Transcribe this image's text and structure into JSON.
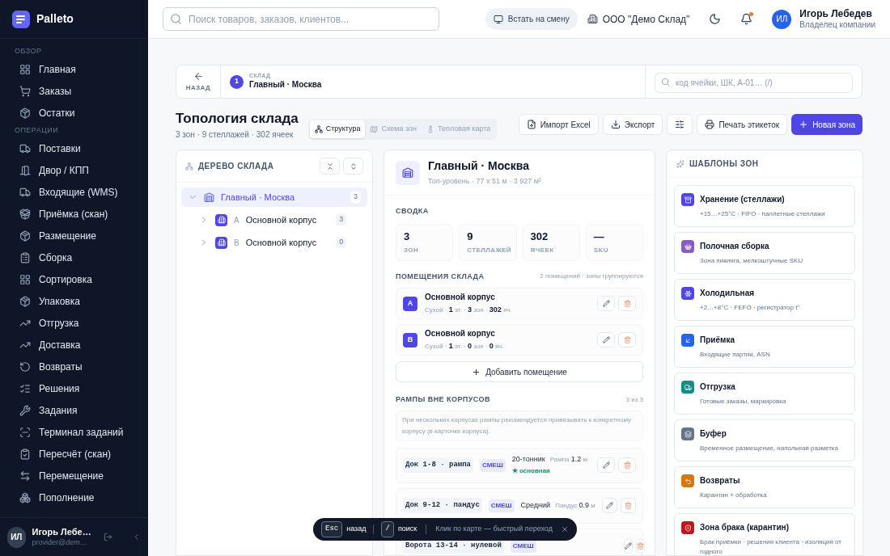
{
  "sidebar": {
    "brand": "Palleto",
    "sections": [
      {
        "title": "ОБЗОР",
        "items": [
          {
            "label": "Главная",
            "selected": false
          },
          {
            "label": "Заказы",
            "selected": false
          },
          {
            "label": "Остатки",
            "selected": false
          }
        ]
      },
      {
        "title": "ОПЕРАЦИИ",
        "items": [
          {
            "label": "Поставки",
            "selected": false
          },
          {
            "label": "Двор / КПП",
            "selected": false
          },
          {
            "label": "Входящие (WMS)",
            "selected": false
          },
          {
            "label": "Приёмка (скан)",
            "selected": false
          },
          {
            "label": "Размещение",
            "selected": false
          },
          {
            "label": "Сборка",
            "selected": false
          },
          {
            "label": "Сортировка",
            "selected": false
          },
          {
            "label": "Упаковка",
            "selected": false
          },
          {
            "label": "Отгрузка",
            "selected": false
          },
          {
            "label": "Доставка",
            "selected": false
          },
          {
            "label": "Возвраты",
            "selected": false
          },
          {
            "label": "Решения",
            "selected": false
          },
          {
            "label": "Задания",
            "selected": false
          },
          {
            "label": "Терминал заданий",
            "selected": false
          },
          {
            "label": "Пересчёт (скан)",
            "selected": false
          },
          {
            "label": "Перемещение",
            "selected": false
          },
          {
            "label": "Пополнение",
            "selected": false
          }
        ]
      }
    ],
    "user": {
      "initials": "ИЛ",
      "name": "Игорь Лебе…",
      "email": "provider@dem…"
    }
  },
  "topbar": {
    "search_placeholder": "Поиск товаров, заказов, клиентов...",
    "shift_button": "Встать на смену",
    "org": "ООО \"Демо Склад\"",
    "notifications_unread": true,
    "user": {
      "initials": "ИЛ",
      "name": "Игорь Лебедев",
      "role": "Владелец компании"
    }
  },
  "breadcrumb": {
    "back": "НАЗАД",
    "step": "1",
    "label": "СКЛАД",
    "value": "Главный · Москва",
    "search_placeholder": "код ячейки, ШК, A-01… (/)"
  },
  "page": {
    "title": "Топология склада",
    "subtitle": "3 зон · 9 стеллажей · 302 ячеек",
    "views": [
      {
        "label": "Структура",
        "selected": true
      },
      {
        "label": "Схема зон",
        "selected": false
      },
      {
        "label": "Тепловая карта",
        "selected": false
      }
    ],
    "actions": [
      {
        "kind": "default",
        "label": "Импорт Excel"
      },
      {
        "kind": "default",
        "label": "Экспорт"
      },
      {
        "kind": "icon"
      },
      {
        "kind": "default",
        "label": "Печать этикеток"
      },
      {
        "kind": "primary",
        "label": "Новая зона"
      }
    ]
  },
  "tree": {
    "title": "ДЕРЕВО СКЛАДА",
    "nodes": [
      {
        "label": "Главный · Москва",
        "count": "3",
        "expanded": true,
        "selected": true,
        "children": [
          {
            "letter": "A",
            "label": "Основной корпус",
            "count": "3",
            "expanded": false,
            "selected": false
          },
          {
            "letter": "B",
            "label": "Основной корпус",
            "count": "0",
            "expanded": false,
            "selected": false
          }
        ]
      }
    ]
  },
  "detail": {
    "title": "Главный · Москва",
    "subtitle": "Топ-уровень · 77 x 51 м · 3 927 м²",
    "summary_title": "СВОДКА",
    "stats": [
      {
        "value": "3",
        "label": "ЗОН"
      },
      {
        "value": "9",
        "label": "СТЕЛЛАЖЕЙ"
      },
      {
        "value": "302",
        "label": "ЯЧЕЕК"
      },
      {
        "value": "—",
        "label": "SKU"
      }
    ],
    "rooms_title": "ПОМЕЩЕНИЯ СКЛАДА",
    "rooms_note": "2 помещений · зоны группируются",
    "rooms": [
      {
        "letter": "A",
        "name": "Основной корпус",
        "meta": "Сухой · **1** эт. · **3** зон · **302** яч."
      },
      {
        "letter": "B",
        "name": "Основной корпус",
        "meta": "Сухой · **1** эт. · **0** зон · **0** яч."
      }
    ],
    "add_room": "Добавить помещение",
    "ramps_title": "РАМПЫ ВНЕ КОРПУСОВ",
    "ramps_count": "3 из 3",
    "ramps_note": "При нескольких корпусах рампы рекомендуется привязывать к конкретному корпусу (в карточке корпуса).",
    "ramps": [
      {
        "code": "Док 1-8 · рампа",
        "tag": "СМЕШ",
        "type": "20-тонник",
        "spec": "Рампа **1.2** м",
        "badge": "★ основная"
      },
      {
        "code": "Док 9-12 · пандус",
        "tag": "СМЕШ",
        "type": "Средний",
        "spec": "Пандус **0.9** м"
      },
      {
        "code": "Ворота 13-14 · нулевой",
        "tag": "СМЕШ"
      }
    ]
  },
  "templates": {
    "title": "ШАБЛОНЫ ЗОН",
    "items": [
      {
        "title": "Хранение (стеллажи)",
        "desc": "+15…+25°C · FIFO · паллетные стеллажи",
        "color": "#4f46e5"
      },
      {
        "title": "Полочная сборка",
        "desc": "Зона пикинга, мелкоштучные SKU",
        "color": "#8b5cc0"
      },
      {
        "title": "Холодильная",
        "desc": "+2…+8°C · FEFO · регистратор t°",
        "color": "#4f46e5"
      },
      {
        "title": "Приёмка",
        "desc": "Входящие партии, ASN",
        "color": "#2563eb"
      },
      {
        "title": "Отгрузка",
        "desc": "Готовые заказы, маркировка",
        "color": "#0f8f85"
      },
      {
        "title": "Буфер",
        "desc": "Временное размещение, напольная разметка",
        "color": "#64748b"
      },
      {
        "title": "Возвраты",
        "desc": "Карантин + обработка",
        "color": "#d97706"
      },
      {
        "title": "Зона брака (карантин)",
        "desc": "Брак приёмки · решения клиента · изоляция от годного",
        "color": "#b91c1c"
      }
    ]
  },
  "hint_bar": {
    "keys": [
      {
        "key": "Esc",
        "label": "назад"
      },
      {
        "key": "/",
        "label": "поиск"
      }
    ],
    "text": "Клик по карте — быстрый переход"
  }
}
